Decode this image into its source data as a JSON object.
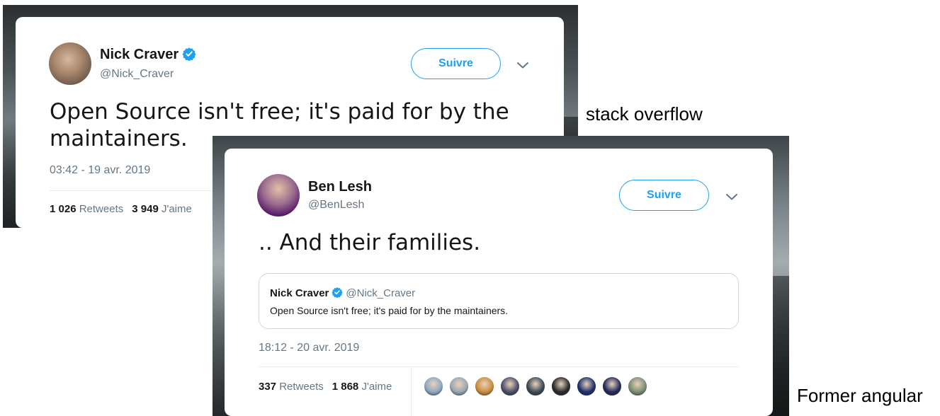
{
  "captions": {
    "first": "stack overflow",
    "second": "Former angular"
  },
  "tweet_one": {
    "display_name": "Nick Craver",
    "handle": "@Nick_Craver",
    "verified": true,
    "follow_label": "Suivre",
    "text": "Open Source isn't free; it's paid for by the maintainers.",
    "timestamp": "03:42 - 19 avr. 2019",
    "retweets_count": "1 026",
    "retweets_label": "Retweets",
    "likes_count": "3 949",
    "likes_label": "J'aime"
  },
  "tweet_two": {
    "display_name": "Ben Lesh",
    "handle": "@BenLesh",
    "verified": false,
    "follow_label": "Suivre",
    "text": ".. And their families.",
    "quote": {
      "display_name": "Nick Craver",
      "handle": "@Nick_Craver",
      "text": "Open Source isn't free; it's paid for by the maintainers."
    },
    "timestamp": "18:12 - 20 avr. 2019",
    "retweets_count": "337",
    "retweets_label": "Retweets",
    "likes_count": "1 868",
    "likes_label": "J'aime",
    "liker_avatar_colors": [
      "#8fa8c0",
      "#9aa7b5",
      "#c98d3d",
      "#4a4f66",
      "#3b4a57",
      "#2a2a2a",
      "#1f2f6b",
      "#232a5e",
      "#7b8f73"
    ]
  },
  "colors": {
    "accent": "#1da1f2",
    "muted": "#657786",
    "text": "#14171a"
  }
}
